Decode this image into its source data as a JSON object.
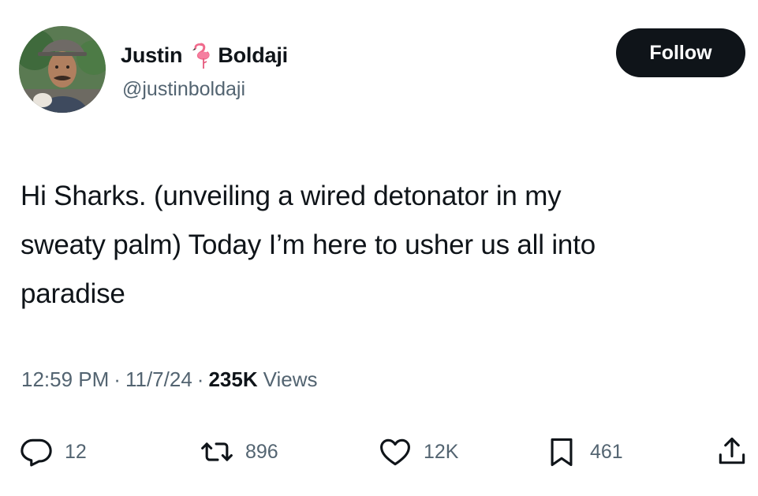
{
  "author": {
    "name_first": "Justin",
    "name_last": "Boldaji",
    "name_emoji": "flamingo-icon",
    "handle": "@justinboldaji",
    "avatar": "avatar-photo"
  },
  "follow_label": "Follow",
  "tweet": {
    "lines": [
      "Hi Sharks. (unveiling a wired detonator in my",
      "sweaty palm) Today I’m here to usher us all into",
      "paradise"
    ]
  },
  "meta": {
    "time": "12:59 PM",
    "separator": "·",
    "date": "11/7/24",
    "views_count": "235K",
    "views_label": "Views"
  },
  "actions": {
    "reply": {
      "icon": "reply-icon",
      "count": "12"
    },
    "retweet": {
      "icon": "retweet-icon",
      "count": "896"
    },
    "like": {
      "icon": "heart-icon",
      "count": "12K"
    },
    "bookmark": {
      "icon": "bookmark-icon",
      "count": "461"
    },
    "share": {
      "icon": "share-icon"
    }
  },
  "colors": {
    "text": "#0f1419",
    "secondary": "#536471",
    "button_bg": "#0f1419",
    "button_text": "#ffffff",
    "background": "#ffffff"
  }
}
